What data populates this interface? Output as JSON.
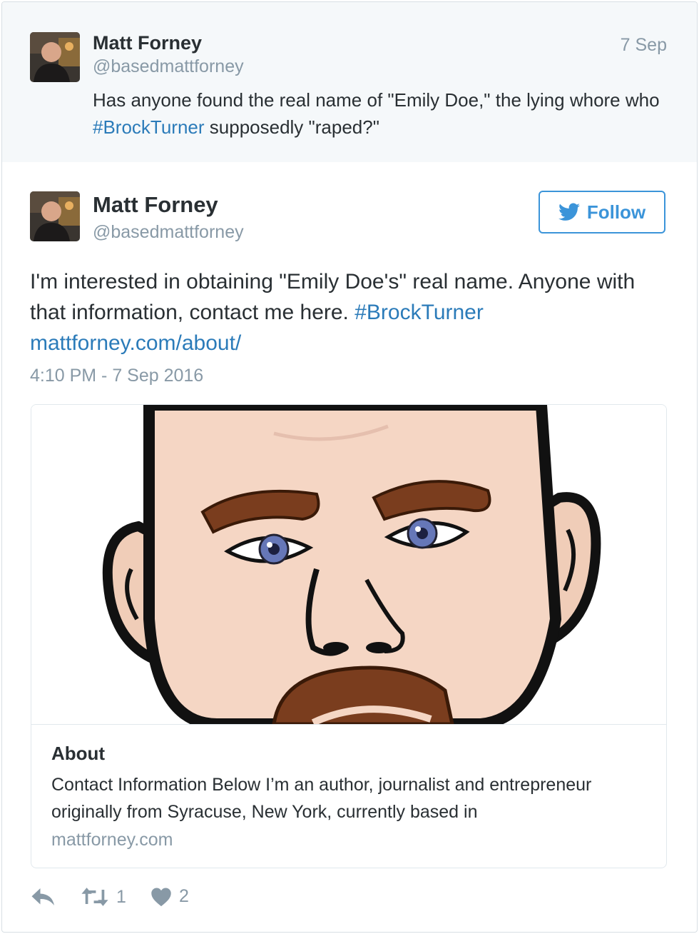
{
  "parent_tweet": {
    "name": "Matt Forney",
    "handle": "@basedmattforney",
    "date": "7 Sep",
    "text_before": "Has anyone found the real name of \"Emily Doe,\" the lying whore who ",
    "hashtag": "#BrockTurner",
    "text_after": " supposedly \"raped?\""
  },
  "main_tweet": {
    "name": "Matt Forney",
    "handle": "@basedmattforney",
    "follow_label": "Follow",
    "text_before": "I'm interested in obtaining \"Emily Doe's\" real name. Anyone with that information, contact me here. ",
    "hashtag": "#BrockTurner",
    "link": "mattforney.com/about/",
    "timestamp": "4:10 PM - 7 Sep 2016"
  },
  "card": {
    "title": "About",
    "description": "Contact Information Below I’m an author, journalist and entrepreneur originally from Syracuse, New York, currently based in",
    "domain": "mattforney.com"
  },
  "actions": {
    "retweet_count": "1",
    "like_count": "2"
  },
  "icons": {
    "follow": "twitter-bird-icon",
    "reply": "reply-icon",
    "retweet": "retweet-icon",
    "like": "heart-icon"
  },
  "colors": {
    "link": "#2b7bb9",
    "follow_accent": "#3b94d9",
    "muted": "#8899a6",
    "parent_bg": "#f5f8fa"
  }
}
